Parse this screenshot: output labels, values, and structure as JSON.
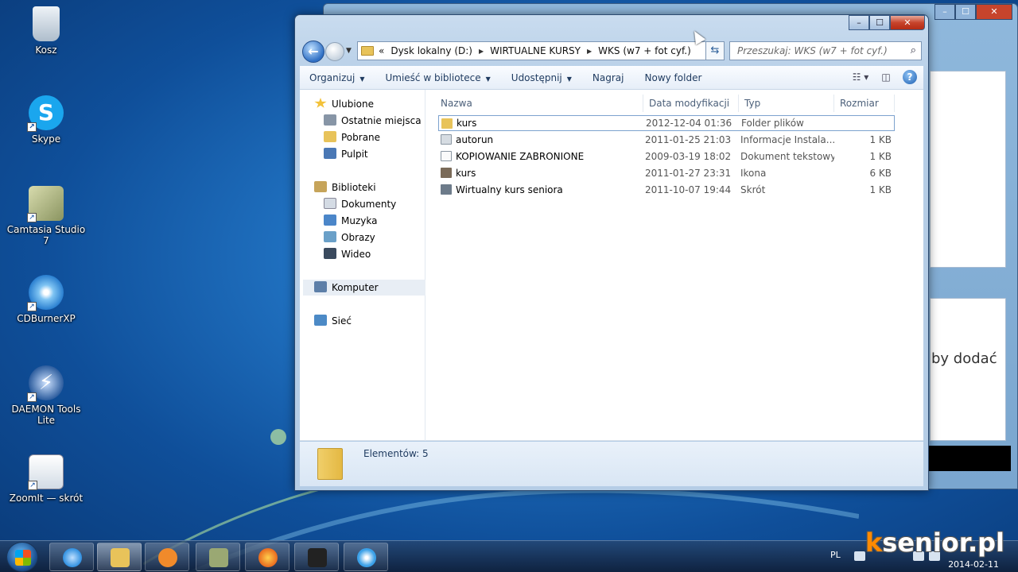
{
  "desktop": {
    "icons": [
      {
        "label": "Kosz",
        "icon": "recycle-bin-icon",
        "color": "#c9d6e3"
      },
      {
        "label": "Skype",
        "icon": "skype-icon",
        "color": "#1aa6ee"
      },
      {
        "label": "Camtasia Studio 7",
        "icon": "camtasia-icon",
        "color": "#9aa873"
      },
      {
        "label": "CDBurnerXP",
        "icon": "cdburner-icon",
        "color": "#3aa0e8"
      },
      {
        "label": "DAEMON Tools Lite",
        "icon": "daemon-tools-icon",
        "color": "#2d5d9e"
      },
      {
        "label": "ZoomIt — skrót",
        "icon": "zoomit-icon",
        "color": "#e9eef3"
      }
    ]
  },
  "background_window": {
    "side_text": "by dodać"
  },
  "explorer": {
    "caption": {
      "minimize": "–",
      "maximize": "☐",
      "close": "✕"
    },
    "address": {
      "prefix": "«",
      "crumbs": [
        "Dysk lokalny (D:)",
        "WIRTUALNE KURSY",
        "WKS (w7 + fot cyf.)"
      ]
    },
    "search": {
      "placeholder": "Przeszukaj: WKS (w7 + fot cyf.)"
    },
    "toolbar": {
      "organize": "Organizuj",
      "library": "Umieść w bibliotece",
      "share": "Udostępnij",
      "burn": "Nagraj",
      "new_folder": "Nowy folder"
    },
    "nav_pane": {
      "favorites": "Ulubione",
      "recent": "Ostatnie miejsca",
      "downloads": "Pobrane",
      "desktop": "Pulpit",
      "libraries": "Biblioteki",
      "documents": "Dokumenty",
      "music": "Muzyka",
      "pictures": "Obrazy",
      "videos": "Wideo",
      "computer": "Komputer",
      "network": "Sieć"
    },
    "columns": {
      "name": "Nazwa",
      "date": "Data modyfikacji",
      "type": "Typ",
      "size": "Rozmiar"
    },
    "files": [
      {
        "name": "kurs",
        "date": "2012-12-04 01:36",
        "type": "Folder plików",
        "size": "",
        "icon": "folder-icon",
        "color": "#e8c35a"
      },
      {
        "name": "autorun",
        "date": "2011-01-25 21:03",
        "type": "Informacje Instala...",
        "size": "1 KB",
        "icon": "settings-file-icon",
        "color": "#9aa6b2"
      },
      {
        "name": "KOPIOWANIE ZABRONIONE",
        "date": "2009-03-19 18:02",
        "type": "Dokument tekstowy",
        "size": "1 KB",
        "icon": "text-file-icon",
        "color": "#f4f4f4"
      },
      {
        "name": "kurs",
        "date": "2011-01-27 23:31",
        "type": "Ikona",
        "size": "6 KB",
        "icon": "icon-file-icon",
        "color": "#7a6a58"
      },
      {
        "name": "Wirtualny kurs seniora",
        "date": "2011-10-07 19:44",
        "type": "Skrót",
        "size": "1 KB",
        "icon": "shortcut-file-icon",
        "color": "#6d7b8a"
      }
    ],
    "status": {
      "items_text": "Elementów: 5"
    }
  },
  "taskbar": {
    "apps": [
      {
        "icon": "internet-explorer-icon",
        "color": "#2f8fe0"
      },
      {
        "icon": "file-explorer-icon",
        "color": "#e8c35a"
      },
      {
        "icon": "media-player-icon",
        "color": "#f08a2b"
      },
      {
        "icon": "camtasia-icon",
        "color": "#9aa873"
      },
      {
        "icon": "firefox-icon",
        "color": "#e86a1f"
      },
      {
        "icon": "recorder-icon",
        "color": "#222"
      },
      {
        "icon": "cdburner-icon",
        "color": "#3aa0e8"
      }
    ],
    "language": "PL",
    "date": "2014-02-11"
  },
  "watermark": {
    "k": "k",
    "text": "senior.pl"
  }
}
